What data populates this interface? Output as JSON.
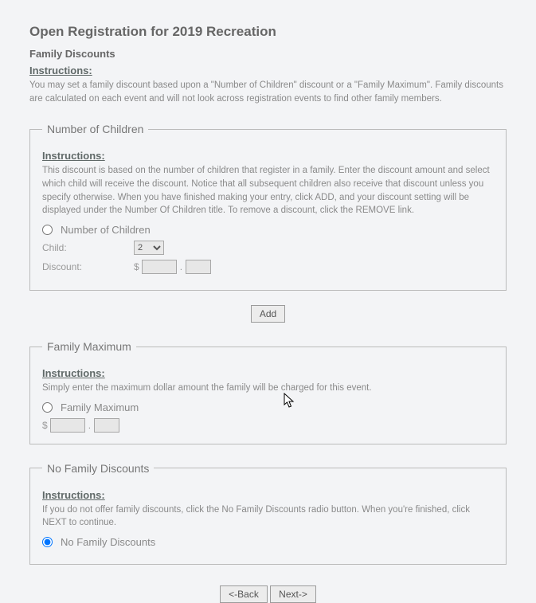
{
  "page": {
    "title": "Open Registration for 2019 Recreation",
    "subtitle": "Family Discounts",
    "instructions_heading": "Instructions:",
    "instructions_body": "You may set a family discount based upon a \"Number of Children\" discount or a \"Family Maximum\". Family discounts are calculated on each event and will not look across registration events to find other family members."
  },
  "sections": {
    "number_of_children": {
      "legend": "Number of Children",
      "instructions_heading": "Instructions:",
      "instructions_body": "This discount is based on the number of children that register in a family. Enter the discount amount and select which child will receive the discount. Notice that all subsequent children also receive that discount unless you specify otherwise. When you have finished making your entry, click ADD, and your discount setting will be displayed under the Number Of Children title. To remove a discount, click the REMOVE link.",
      "radio_label": "Number of Children",
      "child_label": "Child:",
      "child_options": [
        "2"
      ],
      "child_value": "2",
      "discount_label": "Discount:",
      "dollar_sign": "$",
      "dollars": "",
      "cents": ""
    },
    "family_maximum": {
      "legend": "Family Maximum",
      "instructions_heading": "Instructions:",
      "instructions_body": "Simply enter the maximum dollar amount the family will be charged for this event.",
      "radio_label": "Family Maximum",
      "dollar_sign": "$",
      "dollars": "",
      "cents": ""
    },
    "no_family_discounts": {
      "legend": "No Family Discounts",
      "instructions_heading": "Instructions:",
      "instructions_body": "If you do not offer family discounts, click the No Family Discounts radio button. When you're finished, click NEXT to continue.",
      "radio_label": "No Family Discounts"
    }
  },
  "buttons": {
    "add": "Add",
    "back": "<-Back",
    "next": "Next->"
  },
  "radio_selected": "no_family_discounts"
}
